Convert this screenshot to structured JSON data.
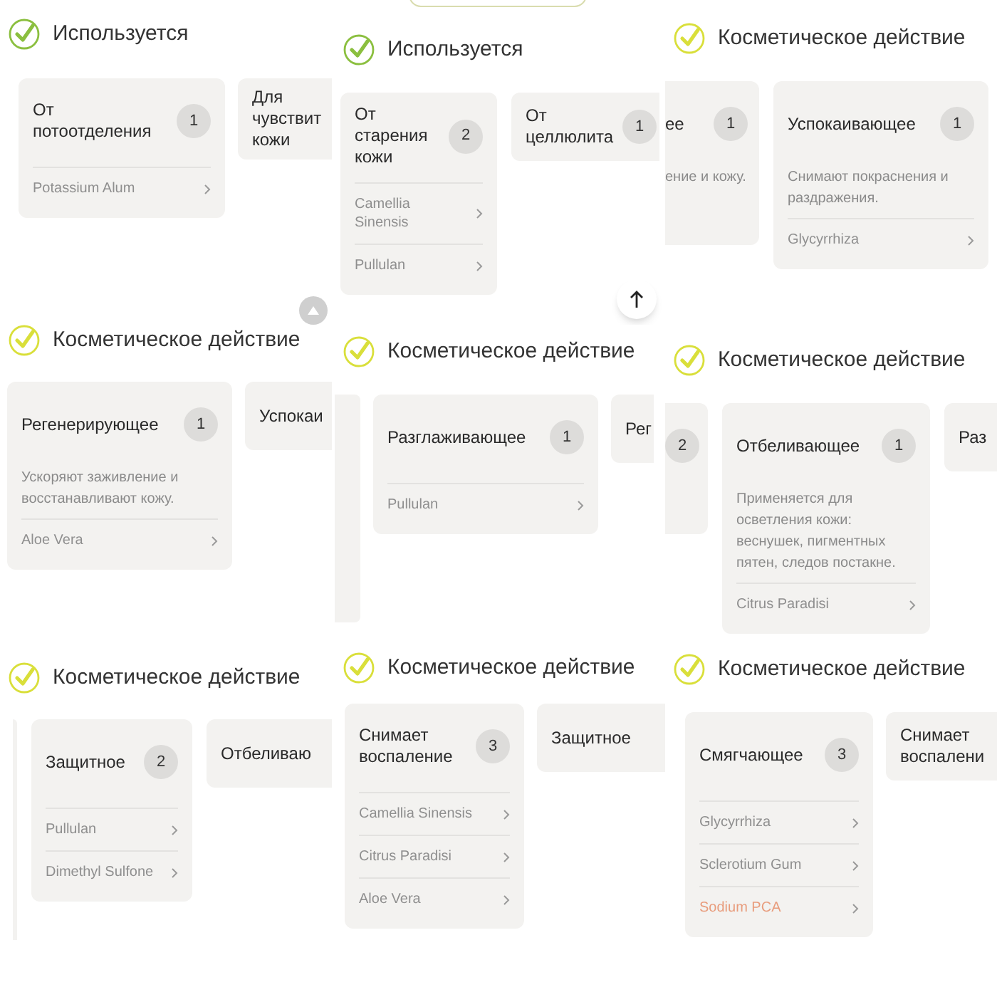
{
  "panels": [
    {
      "header": {
        "title": "Используется",
        "color": "#8bbf3f"
      },
      "cards": [
        {
          "kind": "full",
          "title": "От потоотделения",
          "count": "1",
          "ingredients": [
            {
              "name": "Potassium Alum",
              "highlighted": false
            }
          ]
        },
        {
          "kind": "fragment_right",
          "title": "Для чувствит кожи"
        }
      ]
    },
    {
      "header": {
        "title": "Используется",
        "color": "#8bbf3f"
      },
      "cards": [
        {
          "kind": "full",
          "title": "От старения кожи",
          "count": "2",
          "ingredients": [
            {
              "name": "Camellia Sinensis",
              "highlighted": false
            },
            {
              "name": "Pullulan",
              "highlighted": false
            }
          ]
        },
        {
          "kind": "fragment_right",
          "title": "От целлюлита",
          "count": "1"
        }
      ]
    },
    {
      "header": {
        "title": "Косметическое действие",
        "color": "#d9df3a"
      },
      "cards": [
        {
          "kind": "fragment_left",
          "title": "ее",
          "count": "1",
          "description": "ение и кожу."
        },
        {
          "kind": "full",
          "title": "Успокаивающее",
          "count": "1",
          "description": "Снимают покраснения и раздражения.",
          "ingredients": [
            {
              "name": "Glycyrrhiza",
              "highlighted": false
            }
          ]
        }
      ]
    },
    {
      "header": {
        "title": "Косметическое действие",
        "color": "#d9df3a"
      },
      "cards": [
        {
          "kind": "full",
          "title": "Регенерирующее",
          "count": "1",
          "description": "Ускоряют заживление и восстанавливают кожу.",
          "ingredients": [
            {
              "name": "Aloe Vera",
              "highlighted": false
            }
          ]
        },
        {
          "kind": "fragment_right",
          "title": "Успокаи"
        }
      ]
    },
    {
      "header": {
        "title": "Косметическое действие",
        "color": "#d9df3a"
      },
      "cards": [
        {
          "kind": "strip"
        },
        {
          "kind": "full",
          "title": "Разглаживающее",
          "count": "1",
          "ingredients": [
            {
              "name": "Pullulan",
              "highlighted": false
            }
          ]
        },
        {
          "kind": "fragment_right",
          "title": "Рег"
        }
      ]
    },
    {
      "header": {
        "title": "Косметическое действие",
        "color": "#d9df3a"
      },
      "cards": [
        {
          "kind": "fragment_left",
          "count": "2"
        },
        {
          "kind": "full",
          "title": "Отбеливающее",
          "count": "1",
          "description": "Применяется для осветления кожи: веснушек, пигментных пятен, следов постакне.",
          "ingredients": [
            {
              "name": "Citrus Paradisi",
              "highlighted": false
            }
          ]
        },
        {
          "kind": "fragment_right",
          "title": "Раз"
        }
      ]
    },
    {
      "header": {
        "title": "Косметическое действие",
        "color": "#d9df3a"
      },
      "cards": [
        {
          "kind": "strip"
        },
        {
          "kind": "full",
          "title": "Защитное",
          "count": "2",
          "ingredients": [
            {
              "name": "Pullulan",
              "highlighted": false
            },
            {
              "name": "Dimethyl Sulfone",
              "highlighted": false
            }
          ]
        },
        {
          "kind": "fragment_right",
          "title": "Отбеливаю"
        }
      ]
    },
    {
      "header": {
        "title": "Косметическое действие",
        "color": "#d9df3a"
      },
      "cards": [
        {
          "kind": "full",
          "title": "Снимает воспаление",
          "count": "3",
          "ingredients": [
            {
              "name": "Camellia Sinensis",
              "highlighted": false
            },
            {
              "name": "Citrus Paradisi",
              "highlighted": false
            },
            {
              "name": "Aloe Vera",
              "highlighted": false
            }
          ]
        },
        {
          "kind": "fragment_right",
          "title": "Защитное"
        }
      ]
    },
    {
      "header": {
        "title": "Косметическое действие",
        "color": "#d9df3a"
      },
      "cards": [
        {
          "kind": "full",
          "title": "Смягчающее",
          "count": "3",
          "ingredients": [
            {
              "name": "Glycyrrhiza",
              "highlighted": false
            },
            {
              "name": "Sclerotium Gum",
              "highlighted": false
            },
            {
              "name": "Sodium PCA",
              "highlighted": true
            }
          ]
        },
        {
          "kind": "fragment_right",
          "title": "Снимает воспалени"
        }
      ]
    }
  ]
}
